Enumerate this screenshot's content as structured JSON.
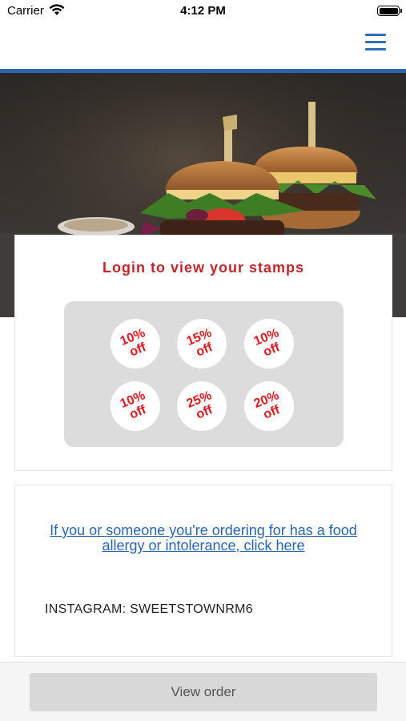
{
  "status_bar": {
    "carrier": "Carrier",
    "time": "4:12 PM"
  },
  "header": {
    "menu_icon": "hamburger-menu-icon",
    "accent_color": "#2f64b4"
  },
  "hero": {
    "image": "burgers-photo"
  },
  "stamps": {
    "title": "Login to view your stamps",
    "title_color": "#c0262c",
    "items": [
      {
        "label": "10%\noff"
      },
      {
        "label": "15%\noff"
      },
      {
        "label": "10%\noff"
      },
      {
        "label": "10%\noff"
      },
      {
        "label": "25%\noff"
      },
      {
        "label": "20%\noff"
      }
    ]
  },
  "info": {
    "allergy_link": "If you or someone you're ordering for has a food allergy or intolerance, click here",
    "instagram": "INSTAGRAM: SWEETSTOWNRM6"
  },
  "bottom": {
    "view_order_label": "View order"
  }
}
